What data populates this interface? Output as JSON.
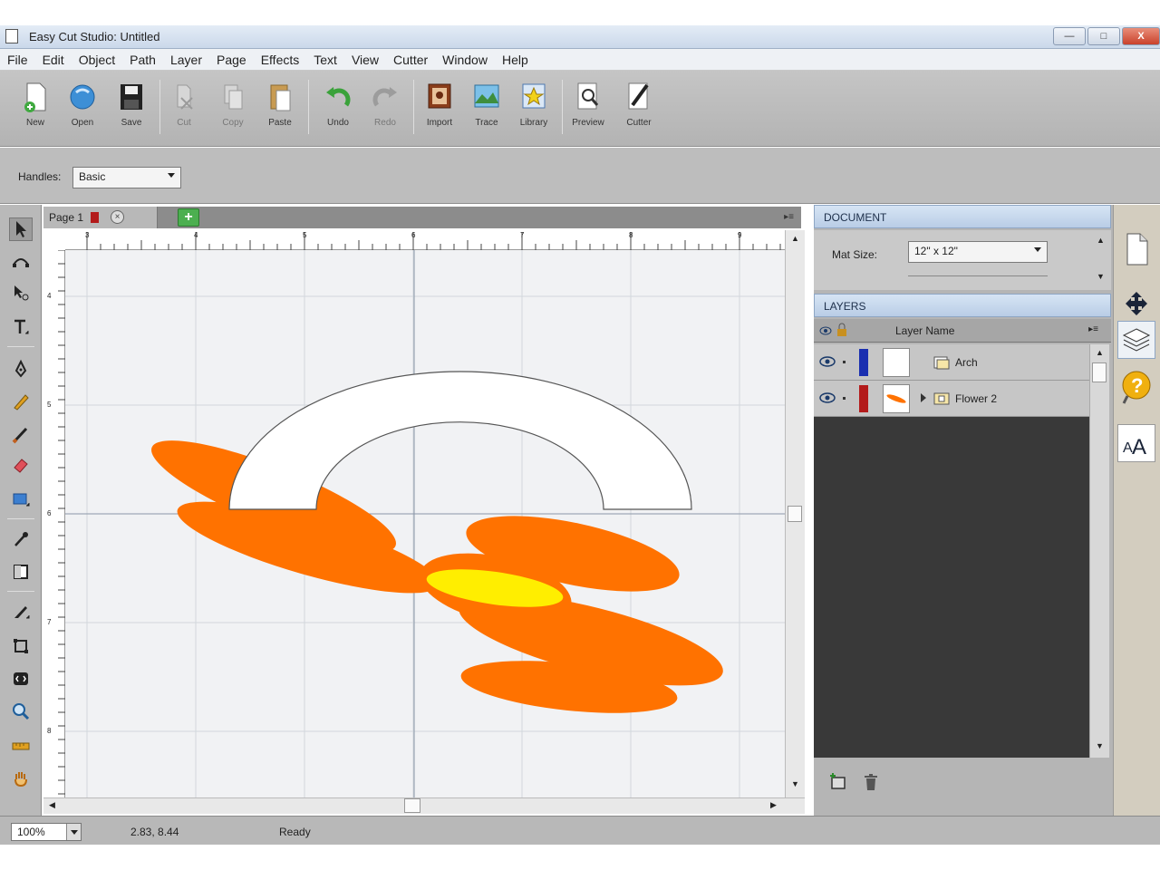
{
  "window": {
    "title": "Easy Cut Studio: Untitled",
    "controls": {
      "minimize": "—",
      "maximize": "□",
      "close": "X"
    }
  },
  "menu": [
    "File",
    "Edit",
    "Object",
    "Path",
    "Layer",
    "Page",
    "Effects",
    "Text",
    "View",
    "Cutter",
    "Window",
    "Help"
  ],
  "toolbar": {
    "new": "New",
    "open": "Open",
    "save": "Save",
    "cut": "Cut",
    "copy": "Copy",
    "paste": "Paste",
    "undo": "Undo",
    "redo": "Redo",
    "import": "Import",
    "trace": "Trace",
    "library": "Library",
    "preview": "Preview",
    "cutter": "Cutter"
  },
  "options": {
    "handles_label": "Handles:",
    "handles_value": "Basic"
  },
  "page_tab": {
    "label": "Page 1",
    "color": "#b31b1b"
  },
  "ruler": {
    "top": [
      "3",
      "4",
      "5",
      "6",
      "7",
      "8",
      "9"
    ],
    "left": [
      "4",
      "5",
      "6",
      "7",
      "8"
    ]
  },
  "document_panel": {
    "header": "DOCUMENT",
    "mat_size_label": "Mat Size:",
    "mat_size_value": "12\" x 12\""
  },
  "layers_panel": {
    "header": "LAYERS",
    "column": "Layer Name",
    "items": [
      {
        "name": "Arch",
        "color": "#1a2fb0"
      },
      {
        "name": "Flower 2",
        "color": "#b31b1b"
      }
    ]
  },
  "canvas_colors": {
    "petals": "#ff7200",
    "center": "#ffee00",
    "arch_fill": "#ffffff",
    "arch_stroke": "#555555"
  },
  "status": {
    "zoom": "100%",
    "coords": "2.83, 8.44",
    "message": "Ready"
  }
}
